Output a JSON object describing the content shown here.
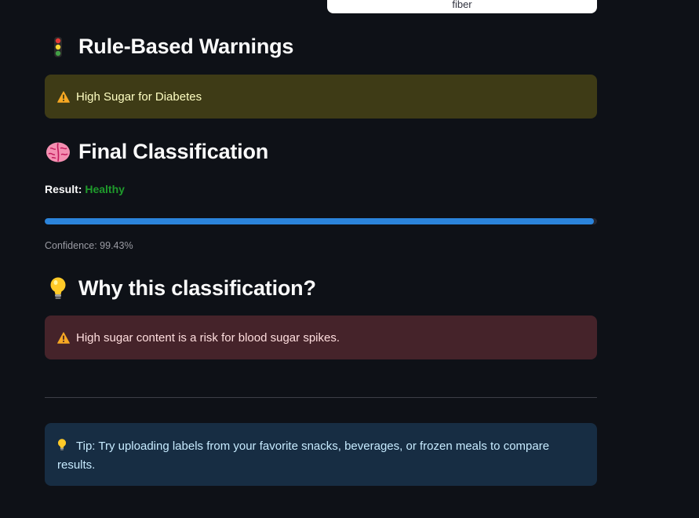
{
  "top_card": {
    "text": "fiber"
  },
  "warnings_section": {
    "emoji": "traffic-light-icon",
    "title": "Rule-Based Warnings",
    "warnings": [
      {
        "icon": "warning-icon",
        "text": "High Sugar for Diabetes"
      }
    ]
  },
  "classification_section": {
    "emoji": "brain-icon",
    "title": "Final Classification",
    "result_label": "Result:",
    "result_value": "Healthy",
    "confidence_fraction": 0.9943,
    "confidence_text": "Confidence: 99.43%"
  },
  "why_section": {
    "emoji": "lightbulb-icon",
    "title": "Why this classification?",
    "reasons": [
      {
        "icon": "warning-icon",
        "text": "High sugar content is a risk for blood sugar spikes."
      }
    ]
  },
  "tip": {
    "icon": "lightbulb-icon",
    "text": "Tip: Try uploading labels from your favorite snacks, beverages, or frozen meals to compare results."
  },
  "colors": {
    "background": "#0e1117",
    "success_text": "#1f9b2c",
    "progress_fill": "#2b84db",
    "warning_bg": "#3e3b16",
    "error_bg": "#45232a",
    "info_bg": "#172d43"
  }
}
